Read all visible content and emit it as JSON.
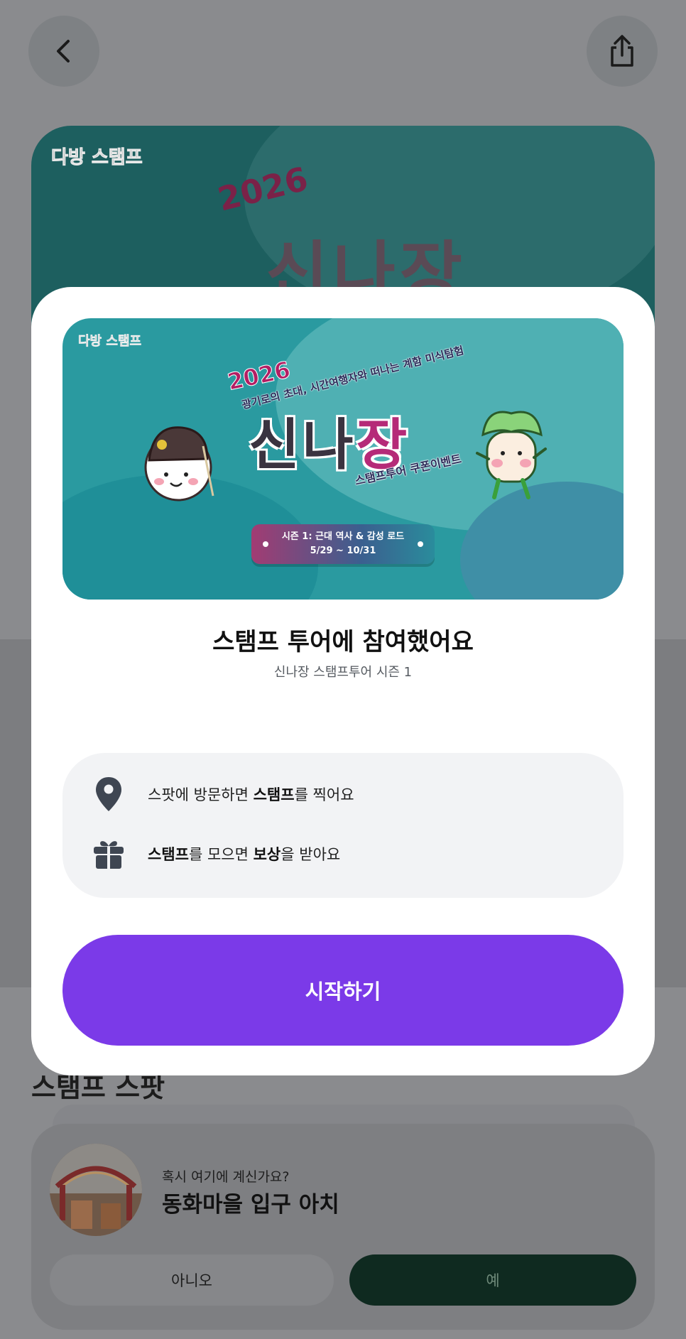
{
  "nav": {
    "back_icon": "chevron-left-icon",
    "share_icon": "share-icon"
  },
  "hero": {
    "logo": "다방 스탬프",
    "year": "2026",
    "title": "신나장"
  },
  "section": {
    "title": "스탬프 스팟"
  },
  "location_prompt": {
    "question": "혹시 여기에 계신가요?",
    "place": "동화마을 입구 아치",
    "no_label": "아니오",
    "yes_label": "예"
  },
  "modal": {
    "banner": {
      "logo": "다방 스탬프",
      "year": "2026",
      "subtitle": "광기로의 초대, 시간여행자와 떠나는 계함 미식탐험",
      "title_prefix": "신나",
      "title_accent": "장",
      "coupon": "스탬프투어 쿠폰이벤트",
      "season_line1": "시즌 1: 근대 역사 & 감성 로드",
      "season_line2": "5/29 ~ 10/31"
    },
    "heading": "스탬프 투어에 참여했어요",
    "subheading": "신나장 스탬프투어 시즌 1",
    "info": [
      {
        "icon": "map-pin-icon",
        "prefix": "스팟에 방문하면 ",
        "bold": "스탬프",
        "suffix": "를 찍어요"
      },
      {
        "icon": "gift-icon",
        "bold1": "스탬프",
        "middle": "를 모으면 ",
        "bold2": "보상",
        "suffix": "을 받아요"
      }
    ],
    "start_label": "시작하기"
  },
  "colors": {
    "primary": "#7b3ae8",
    "banner_teal": "#2a9aa0",
    "overlay": "#8a8b8e",
    "yes_button": "#0f2a20"
  }
}
